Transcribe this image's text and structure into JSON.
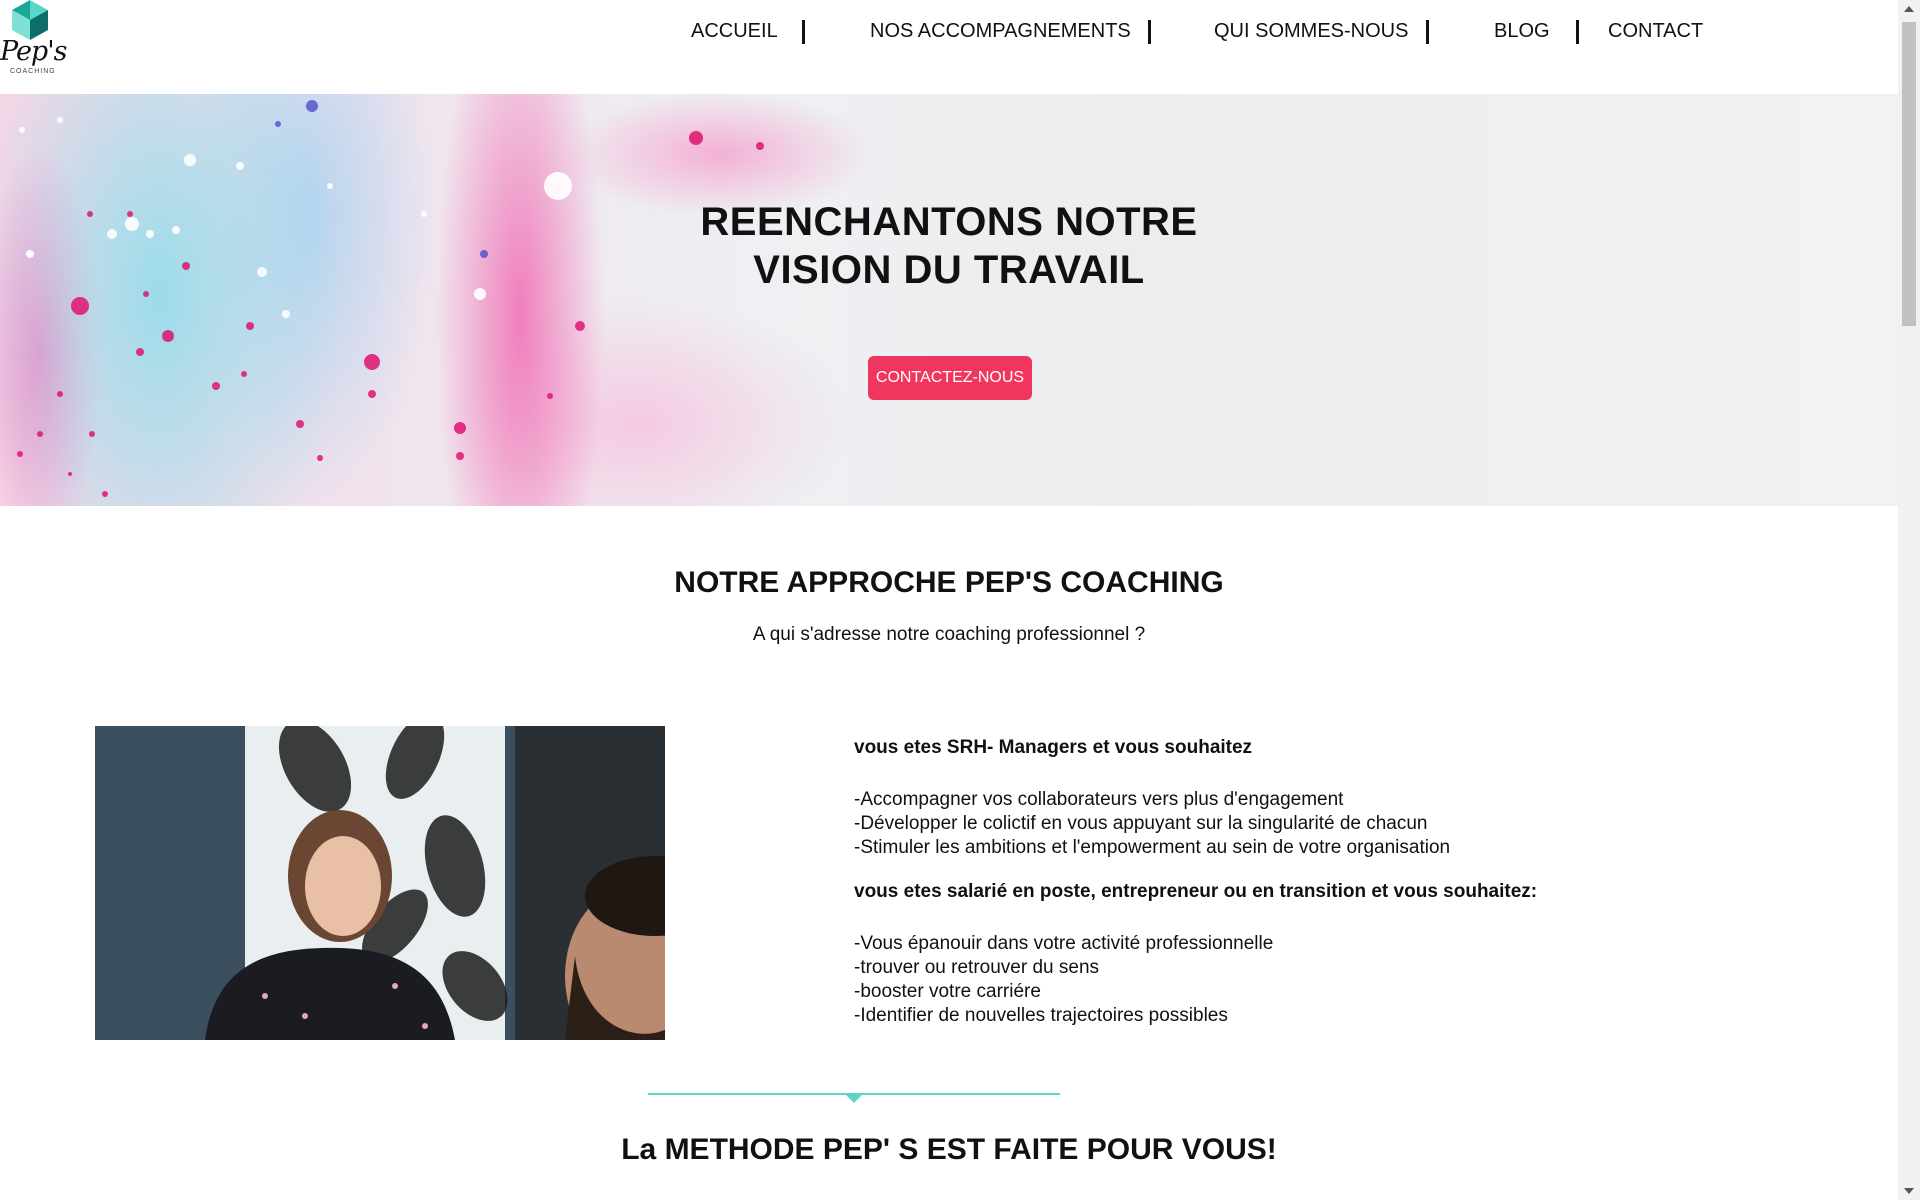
{
  "logo": {
    "name": "Pep's",
    "sub": "COACHING",
    "icon": "hexagon-logo-icon",
    "colors": [
      "#17a89a",
      "#5ad6c8",
      "#0d6d6a"
    ]
  },
  "nav": {
    "items": [
      "ACCUEIL",
      "NOS ACCOMPAGNEMENTS",
      "QUI SOMMES-NOUS",
      "BLOG",
      "CONTACT"
    ]
  },
  "hero": {
    "title_line1": "REENCHANTONS NOTRE",
    "title_line2": "VISION DU TRAVAIL",
    "cta": "CONTACTEZ-NOUS",
    "cta_color": "#f0365f"
  },
  "approach": {
    "title": "NOTRE APPROCHE PEP'S COACHING",
    "subtitle": "A qui s'adresse notre coaching professionnel ?",
    "group1": {
      "heading": "vous etes SRH- Managers et vous souhaitez",
      "items": [
        "-Accompagner vos collaborateurs vers plus d'engagement",
        "-Développer le colictif en vous appuyant sur la singularité de chacun",
        "-Stimuler les ambitions et l'empowerment au sein de votre organisation"
      ]
    },
    "group2": {
      "heading": "vous etes salarié en poste, entrepreneur ou en transition et vous souhaitez:",
      "items": [
        "-Vous épanouir dans votre activité professionnelle",
        "-trouver ou retrouver du sens",
        "-booster votre carriére",
        "-Identifier de nouvelles trajectoires possibles"
      ]
    }
  },
  "methode": {
    "title": "La METHODE PEP' S EST FAITE POUR VOUS!",
    "divider_color": "#5ad6c8"
  }
}
